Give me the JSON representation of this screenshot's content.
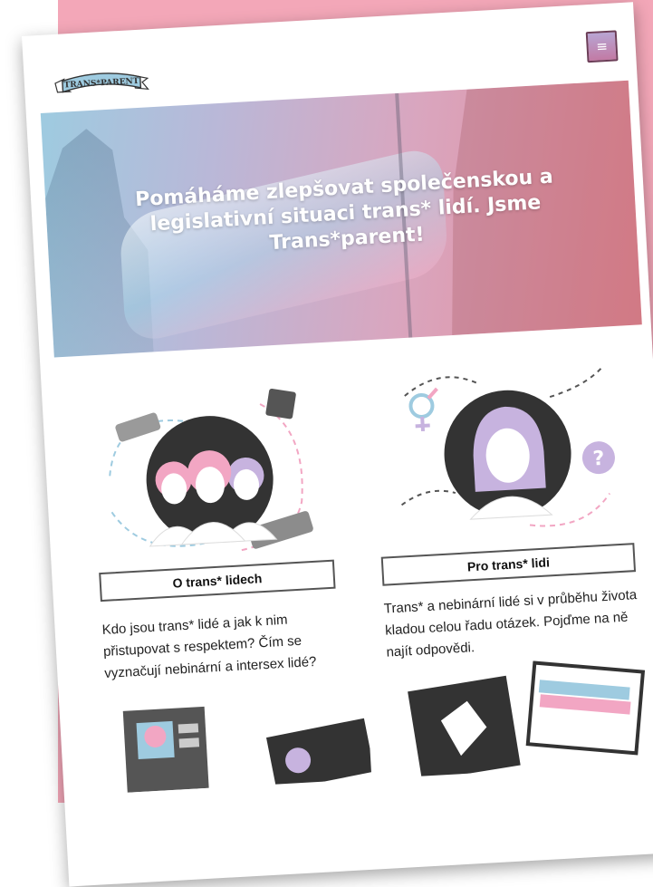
{
  "header": {
    "logo_text": "TRANS*PARENT",
    "menu_icon": "hamburger-icon",
    "menu_glyph": "≡"
  },
  "hero": {
    "title": "Pomáháme zlepšovat společenskou a legislativní situaci trans* lidí. Jsme Trans*parent!"
  },
  "cards": [
    {
      "button_label": "O trans* lidech",
      "text": "Kdo jsou trans* lidé a jak k nim přistupovat s respektem? Čím se vyznačují nebinární a intersex lidé?"
    },
    {
      "button_label": "Pro trans* lidi",
      "text": "Trans* a nebinární lidé si v průběhu života kladou celou řadu otázek. Pojďme na ně najít odpovědi."
    }
  ],
  "colors": {
    "backdrop": "#f3a7b8",
    "trans_blue": "#9ecbe0",
    "trans_pink": "#f2a6c3"
  }
}
